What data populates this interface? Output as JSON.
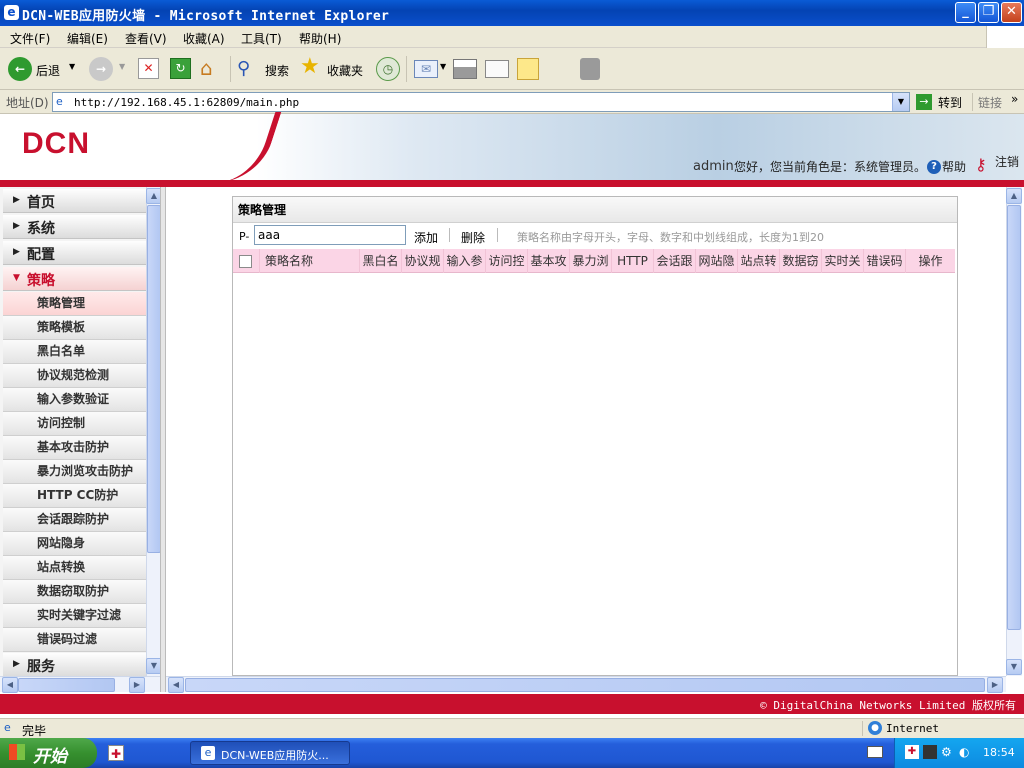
{
  "window": {
    "title": "DCN-WEB应用防火墙 - Microsoft Internet Explorer"
  },
  "menu": [
    "文件(F)",
    "编辑(E)",
    "查看(V)",
    "收藏(A)",
    "工具(T)",
    "帮助(H)"
  ],
  "toolbar": {
    "back_label": "后退",
    "search_label": "搜索",
    "favorites_label": "收藏夹"
  },
  "address": {
    "label": "地址(D)",
    "url": "http://192.168.45.1:62809/main.php",
    "go_label": "转到",
    "links_label": "链接"
  },
  "header": {
    "logo": "DCN",
    "user": "admin",
    "greeting": "您好，您当前角色是：系统管理员。",
    "help_label": "帮助",
    "logout_label": "注销"
  },
  "sidebar": {
    "top_categories": [
      "首页",
      "系统",
      "配置"
    ],
    "open_category": "策略",
    "items": [
      "策略管理",
      "策略模板",
      "黑白名单",
      "协议规范检测",
      "输入参数验证",
      "访问控制",
      "基本攻击防护",
      "暴力浏览攻击防护",
      "HTTP CC防护",
      "会话跟踪防护",
      "网站隐身",
      "站点转换",
      "数据窃取防护",
      "实时关键字过滤",
      "错误码过滤"
    ],
    "bottom_category": "服务",
    "active_index": 0
  },
  "panel": {
    "title": "策略管理",
    "prefix": "P-",
    "name_value": "aaa",
    "add_label": "添加",
    "delete_label": "删除",
    "hint": "策略名称由字母开头，字母、数字和中划线组成，长度为1到20",
    "columns": [
      "策略名称",
      "黑白名",
      "协议规",
      "输入参",
      "访问控",
      "基本攻",
      "暴力浏",
      "HTTP",
      "会话跟",
      "网站隐",
      "站点转",
      "数据窃",
      "实时关",
      "错误码",
      "操作"
    ]
  },
  "footer": {
    "copyright": "© DigitalChina Networks Limited 版权所有"
  },
  "status": {
    "text": "完毕",
    "zone": "Internet"
  },
  "taskbar": {
    "start_label": "开始",
    "task_label": "DCN-WEB应用防火...",
    "clock": "18:54"
  }
}
